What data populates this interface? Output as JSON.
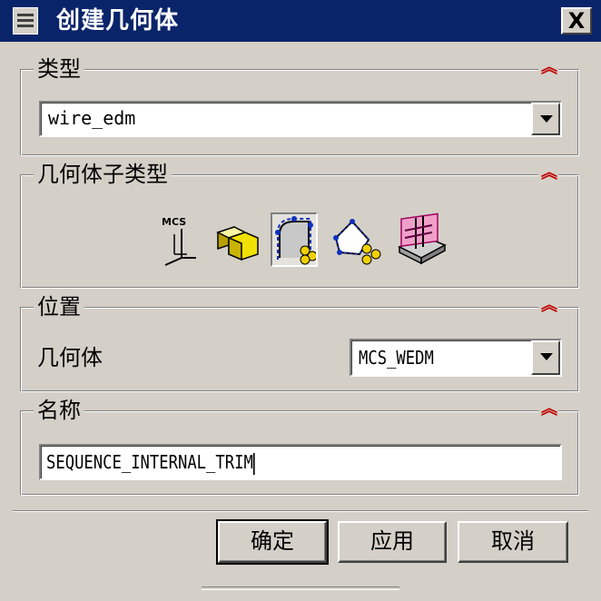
{
  "window": {
    "title": "创建几何体",
    "close_label": "X"
  },
  "type_group": {
    "label": "类型",
    "collapse_glyph": "︽",
    "selected_value": "wire_edm"
  },
  "subtype_group": {
    "label": "几何体子类型",
    "collapse_glyph": "︽",
    "items": [
      {
        "icon": "mcs-icon",
        "text": "MCS",
        "selected": false
      },
      {
        "icon": "workpiece-icon",
        "selected": false
      },
      {
        "icon": "external-trim-icon",
        "selected": true
      },
      {
        "icon": "internal-trim-icon",
        "selected": false
      },
      {
        "icon": "sequence-icon",
        "selected": false
      }
    ]
  },
  "position_group": {
    "label": "位置",
    "collapse_glyph": "︽",
    "geometry_label": "几何体",
    "geometry_value": "MCS_WEDM"
  },
  "name_group": {
    "label": "名称",
    "collapse_glyph": "︽",
    "name_value": "SEQUENCE_INTERNAL_TRIM"
  },
  "buttons": {
    "ok": "确定",
    "apply": "应用",
    "cancel": "取消"
  },
  "colors": {
    "titlebar": "#0a246a",
    "dialog_bg": "#d4d0c8",
    "collapse_arrow": "#c00000"
  }
}
